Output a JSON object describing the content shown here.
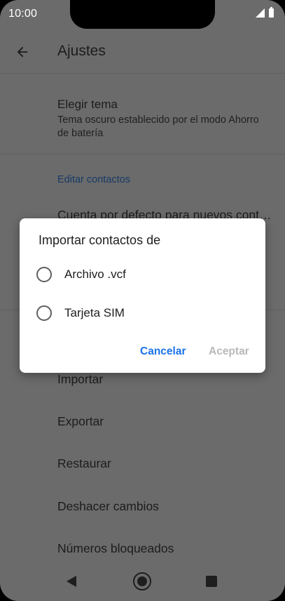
{
  "status_bar": {
    "time": "10:00"
  },
  "app_bar": {
    "title": "Ajustes"
  },
  "settings": {
    "theme": {
      "title": "Elegir tema",
      "subtitle": "Tema oscuro establecido por el modo Ahorro de batería"
    },
    "section_edit_contacts": "Editar contactos",
    "default_account": "Cuenta por defecto para nuevos cont…",
    "items": {
      "import": "Importar",
      "export": "Exportar",
      "restore": "Restaurar",
      "undo_changes": "Deshacer cambios",
      "blocked_numbers": "Números bloqueados"
    }
  },
  "dialog": {
    "title": "Importar contactos de",
    "options": [
      "Archivo .vcf",
      "Tarjeta SIM"
    ],
    "cancel_label": "Cancelar",
    "ok_label": "Aceptar"
  },
  "colors": {
    "scrim": "#6b6b6b",
    "accent": "#1a73e8",
    "disabled": "#b8b8b8"
  }
}
